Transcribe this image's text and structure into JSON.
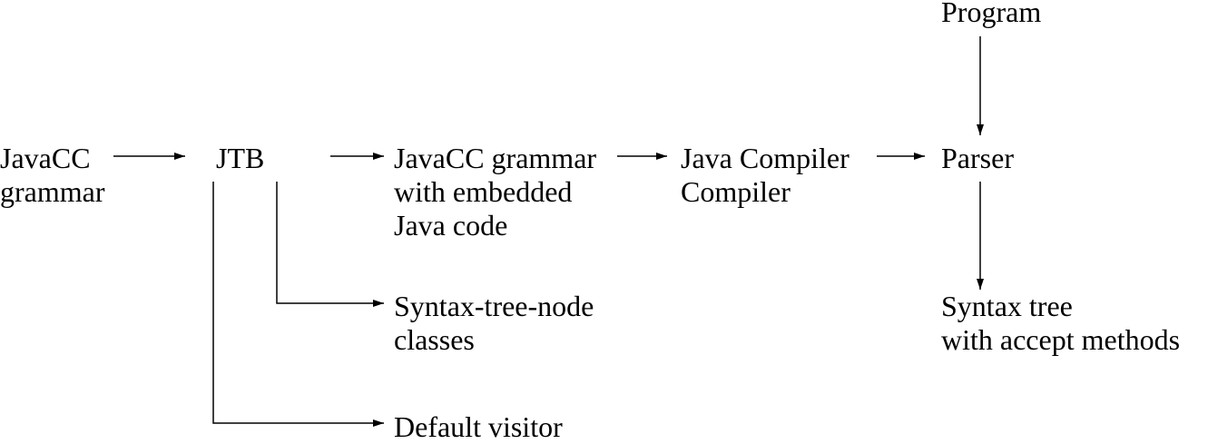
{
  "diagram": {
    "nodes": {
      "program": {
        "lines": [
          "Program"
        ]
      },
      "javacc_grammar": {
        "lines": [
          "JavaCC",
          "grammar"
        ]
      },
      "jtb": {
        "lines": [
          "JTB"
        ]
      },
      "grammar_embedded": {
        "lines": [
          "JavaCC grammar",
          "with embedded",
          "Java code"
        ]
      },
      "java_cc": {
        "lines": [
          "Java Compiler",
          "Compiler"
        ]
      },
      "parser": {
        "lines": [
          "Parser"
        ]
      },
      "syntax_node_classes": {
        "lines": [
          "Syntax-tree-node",
          "classes"
        ]
      },
      "syntax_tree": {
        "lines": [
          "Syntax tree",
          "with accept methods"
        ]
      },
      "default_visitor": {
        "lines": [
          "Default visitor"
        ]
      }
    },
    "edges": [
      {
        "from": "javacc_grammar",
        "to": "jtb"
      },
      {
        "from": "jtb",
        "to": "grammar_embedded"
      },
      {
        "from": "grammar_embedded",
        "to": "java_cc"
      },
      {
        "from": "java_cc",
        "to": "parser"
      },
      {
        "from": "program",
        "to": "parser"
      },
      {
        "from": "parser",
        "to": "syntax_tree"
      },
      {
        "from": "jtb",
        "to": "syntax_node_classes"
      },
      {
        "from": "jtb",
        "to": "default_visitor"
      }
    ],
    "colors": {
      "ink": "#000000",
      "background": "#ffffff"
    }
  }
}
